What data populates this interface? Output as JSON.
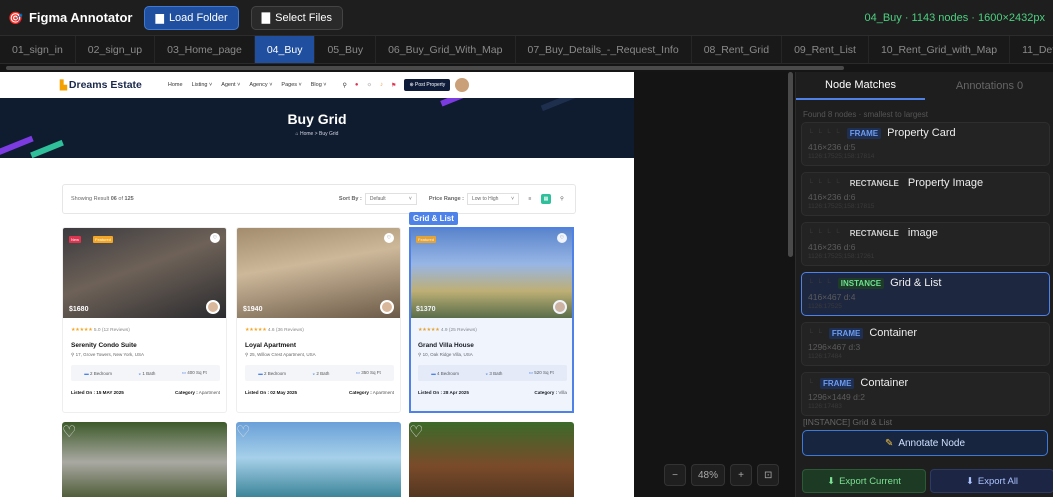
{
  "app": {
    "title": "Figma Annotator",
    "load_folder": "Load Folder",
    "select_files": "Select Files",
    "info": "04_Buy · 1143 nodes · 1600×2432px"
  },
  "tabs": [
    {
      "label": "01_sign_in"
    },
    {
      "label": "02_sign_up"
    },
    {
      "label": "03_Home_page"
    },
    {
      "label": "04_Buy",
      "active": true
    },
    {
      "label": "05_Buy"
    },
    {
      "label": "06_Buy_Grid_With_Map"
    },
    {
      "label": "07_Buy_Details_-_Request_Info"
    },
    {
      "label": "08_Rent_Grid"
    },
    {
      "label": "09_Rent_List"
    },
    {
      "label": "10_Rent_Grid_with_Map"
    },
    {
      "label": "11_Detail_Page_For_Re"
    }
  ],
  "site": {
    "logo": "Dreams Estate",
    "nav": [
      "Home",
      "Listing ˅",
      "Agent ˅",
      "Agency ˅",
      "Pages ˅",
      "Blog ˅"
    ],
    "post_property": "⊕ Post Property",
    "hero_title": "Buy Grid",
    "breadcrumb": "⌂ Home  >  Buy Grid",
    "showing": "Showing Result",
    "showing_count": "06",
    "showing_of": "of",
    "showing_total": "125",
    "sort_label": "Sort By :",
    "sort_value": "Default",
    "price_label": "Price Range :",
    "price_value": "Low to High"
  },
  "selection_label": "Grid & List",
  "cards": [
    {
      "price": "$1680",
      "rating": "5.0 (12 Reviews)",
      "name": "Serenity Condo Suite",
      "address": "17, Grove Towers, New York, USA",
      "bed": "2 Bedroom",
      "bath": "1 Bath",
      "area": "400 Sq Ft",
      "listed": "Listed On : 15 MAY 2025",
      "category_label": "Category :",
      "category": "Apartment",
      "badges": [
        "New",
        "Featured"
      ]
    },
    {
      "price": "$1940",
      "rating": "4.6 (36 Reviews)",
      "name": "Loyal Apartment",
      "address": "25, Willow Crest Apartment, USA",
      "bed": "2 Bedroom",
      "bath": "2 Bath",
      "area": "350 Sq Ft",
      "listed": "Listed On : 02 May 2025",
      "category_label": "Category :",
      "category": "Apartment",
      "badges": []
    },
    {
      "price": "$1370",
      "rating": "4.9 (25 Reviews)",
      "name": "Grand Villa House",
      "address": "10, Oak Ridge Villa, USA",
      "bed": "4 Bedroom",
      "bath": "3 Bath",
      "area": "520 Sq Ft",
      "listed": "Listed On : 28 Apr 2025",
      "category_label": "Category :",
      "category": "Villa",
      "badges": [
        "Featured"
      ]
    }
  ],
  "zoom": {
    "minus": "−",
    "value": "48%",
    "plus": "+",
    "fit": "⊡"
  },
  "panel": {
    "tab_matches": "Node Matches",
    "tab_annotations": "Annotations 0",
    "found": "Found 8 nodes · smallest to largest",
    "nodes": [
      {
        "type": "FRAME",
        "name": "Property Card",
        "dims": "416×236  d:5",
        "id": "1126:17525;158:17814"
      },
      {
        "type": "RECTANGLE",
        "name": "Property Image",
        "dims": "416×236  d:6",
        "id": "1126:17525;158:17815"
      },
      {
        "type": "RECTANGLE",
        "name": "image",
        "dims": "416×236  d:6",
        "id": "1126:17525;158:17261"
      },
      {
        "type": "INSTANCE",
        "name": "Grid & List",
        "dims": "416×467  d:4",
        "id": "1126:17525",
        "selected": true
      },
      {
        "type": "FRAME",
        "name": "Container",
        "dims": "1296×467  d:3",
        "id": "1126:17484"
      },
      {
        "type": "FRAME",
        "name": "Container",
        "dims": "1296×1449  d:2",
        "id": "1126:17483"
      }
    ],
    "selected_info": "[INSTANCE] Grid & List",
    "annotate": "Annotate Node",
    "export_current": "Export Current",
    "export_all": "Export All"
  },
  "colors": {
    "accent": "#4e82e8",
    "status_green": "#4cd080",
    "hero_bg": "#0f1b2e"
  }
}
